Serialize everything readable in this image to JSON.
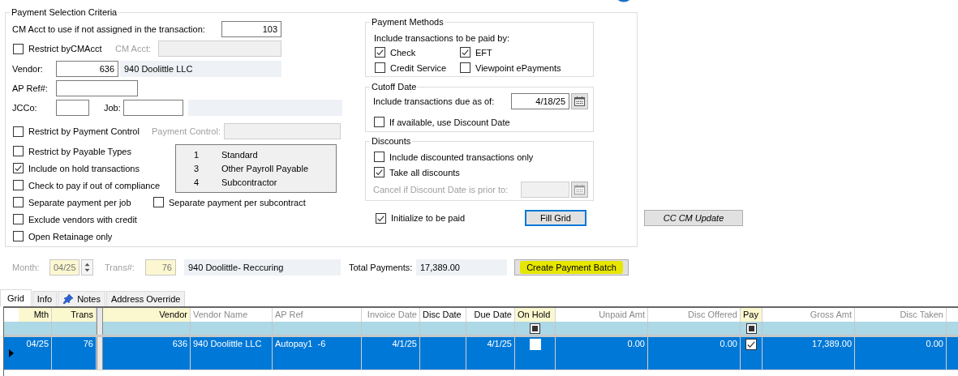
{
  "criteria": {
    "title": "Payment Selection Criteria",
    "cm_account": {
      "label": "CM Acct to use if not assigned in the transaction:",
      "value": "103"
    },
    "restrict_cm": {
      "label": "Restrict byCMAcct",
      "checked": false,
      "field_label": "CM Acct:",
      "disabled": true
    },
    "vendor": {
      "label": "Vendor:",
      "value": "636",
      "name": "940 Doolittle LLC"
    },
    "ap_ref": {
      "label": "AP Ref#:"
    },
    "jcco": {
      "label": "JCCo:"
    },
    "job": {
      "label": "Job:"
    },
    "payment_control": {
      "label": "Restrict by Payment Control",
      "checked": false,
      "field_label": "Payment Control:",
      "disabled": true
    },
    "options": [
      {
        "label": "Restrict by Payable Types",
        "checked": false
      },
      {
        "label": "Include on hold transactions",
        "checked": true
      },
      {
        "label": "Check to pay if out of compliance",
        "checked": false
      },
      {
        "label": "Separate payment per job",
        "checked": false
      },
      {
        "label": "Separate payment per subcontract",
        "checked": false
      },
      {
        "label": "Exclude vendors with credit",
        "checked": false
      },
      {
        "label": "Open Retainage only",
        "checked": false
      }
    ],
    "payable_types": [
      {
        "code": "1",
        "name": "Standard"
      },
      {
        "code": "3",
        "name": "Other Payroll Payable"
      },
      {
        "code": "4",
        "name": "Subcontractor"
      }
    ],
    "payment_methods": {
      "title": "Payment Methods",
      "prompt": "Include transactions to be paid by:",
      "methods": [
        {
          "label": "Check",
          "checked": true
        },
        {
          "label": "EFT",
          "checked": true
        },
        {
          "label": "Credit Service",
          "checked": false
        },
        {
          "label": "Viewpoint ePayments",
          "checked": false
        }
      ]
    },
    "cutoff": {
      "title": "Cutoff Date",
      "label": "Include transactions due as of:",
      "date": "4/18/25",
      "use_discount_date": {
        "label": "If available, use Discount Date",
        "checked": false
      }
    },
    "discounts": {
      "title": "Discounts",
      "options": [
        {
          "label": "Include discounted transactions only",
          "checked": false
        },
        {
          "label": "Take all discounts",
          "checked": true
        }
      ],
      "cancel": {
        "label": "Cancel if Discount Date is prior to:",
        "disabled": true
      }
    },
    "initialize": {
      "label": "Initialize to be paid",
      "checked": true
    },
    "fill_grid": {
      "label": "Fill Grid",
      "focused": true
    }
  },
  "cc_cm_update": {
    "label": "CC CM Update"
  },
  "batch": {
    "month_label": "Month:",
    "month": "04/25",
    "trans_label": "Trans#:",
    "trans": "76",
    "description": "940 Doolittle- Reccuring",
    "total_label": "Total Payments:",
    "total": "17,389.00",
    "create_button": "Create Payment Batch"
  },
  "tabs": [
    {
      "label": "Grid",
      "selected": true,
      "kind": "plain"
    },
    {
      "label": "Info",
      "selected": false,
      "kind": "plain"
    },
    {
      "label": "Notes",
      "selected": false,
      "kind": "pinned"
    },
    {
      "label": "Address Override",
      "selected": false,
      "kind": "plain"
    }
  ],
  "grid": {
    "columns": [
      {
        "label": "Mth",
        "kind": "text",
        "highlighted": true,
        "disabled": false
      },
      {
        "label": "Trans",
        "kind": "text",
        "highlighted": true,
        "disabled": false
      },
      {
        "label": "Vendor",
        "kind": "text",
        "highlighted": true,
        "disabled": false
      },
      {
        "label": "Vendor Name",
        "kind": "text",
        "highlighted": false,
        "disabled": true
      },
      {
        "label": "AP Ref",
        "kind": "text",
        "highlighted": false,
        "disabled": true
      },
      {
        "label": "Invoice Date",
        "kind": "text",
        "highlighted": false,
        "disabled": true
      },
      {
        "label": "Disc Date",
        "kind": "text",
        "highlighted": false,
        "disabled": false
      },
      {
        "label": "Due Date",
        "kind": "text",
        "highlighted": false,
        "disabled": false
      },
      {
        "label": "On Hold",
        "kind": "check",
        "highlighted": true,
        "disabled": false,
        "indeterminate": true
      },
      {
        "label": "Unpaid Amt",
        "kind": "text",
        "highlighted": false,
        "disabled": true
      },
      {
        "label": "Disc Offered",
        "kind": "text",
        "highlighted": false,
        "disabled": true
      },
      {
        "label": "Pay",
        "kind": "check",
        "highlighted": true,
        "disabled": false,
        "indeterminate": true
      },
      {
        "label": "Gross Amt",
        "kind": "text",
        "highlighted": false,
        "disabled": true
      },
      {
        "label": "Disc Taken",
        "kind": "text",
        "highlighted": false,
        "disabled": true
      }
    ],
    "rows": [
      {
        "selected": true,
        "cells": [
          "04/25",
          "76",
          "636",
          "940 Doolittle LLC",
          "Autopay1  -6",
          "4/1/25",
          null,
          "4/1/25",
          false,
          "0.00",
          "0.00",
          true,
          "17,389.00",
          "0.00"
        ]
      }
    ]
  }
}
